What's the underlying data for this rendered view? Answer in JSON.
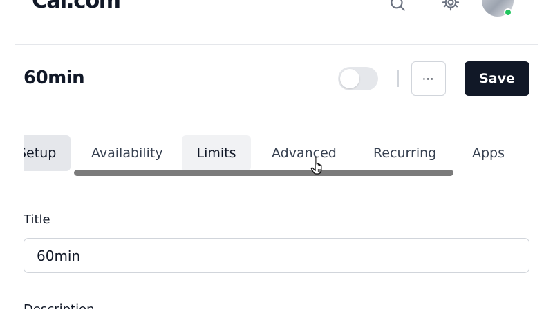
{
  "header": {
    "logo_text": "Cal.com",
    "icons": [
      "search-icon",
      "gear-icon"
    ],
    "avatar_status_color": "#22c55e"
  },
  "event": {
    "title": "60min",
    "toggle_on": false,
    "more_label": "···",
    "save_label": "Save"
  },
  "tabs": [
    {
      "label": "Setup",
      "active": true
    },
    {
      "label": "Availability",
      "active": false
    },
    {
      "label": "Limits",
      "active": false
    },
    {
      "label": "Advanced",
      "active": false
    },
    {
      "label": "Recurring",
      "active": false
    },
    {
      "label": "Apps",
      "active": false
    }
  ],
  "form": {
    "title_label": "Title",
    "title_value": "60min",
    "description_label": "Description"
  },
  "colors": {
    "primary_button": "#111827",
    "border": "#d1d5db",
    "tab_active_bg": "#e5e7eb",
    "scrollbar": "#7b7b7b"
  }
}
